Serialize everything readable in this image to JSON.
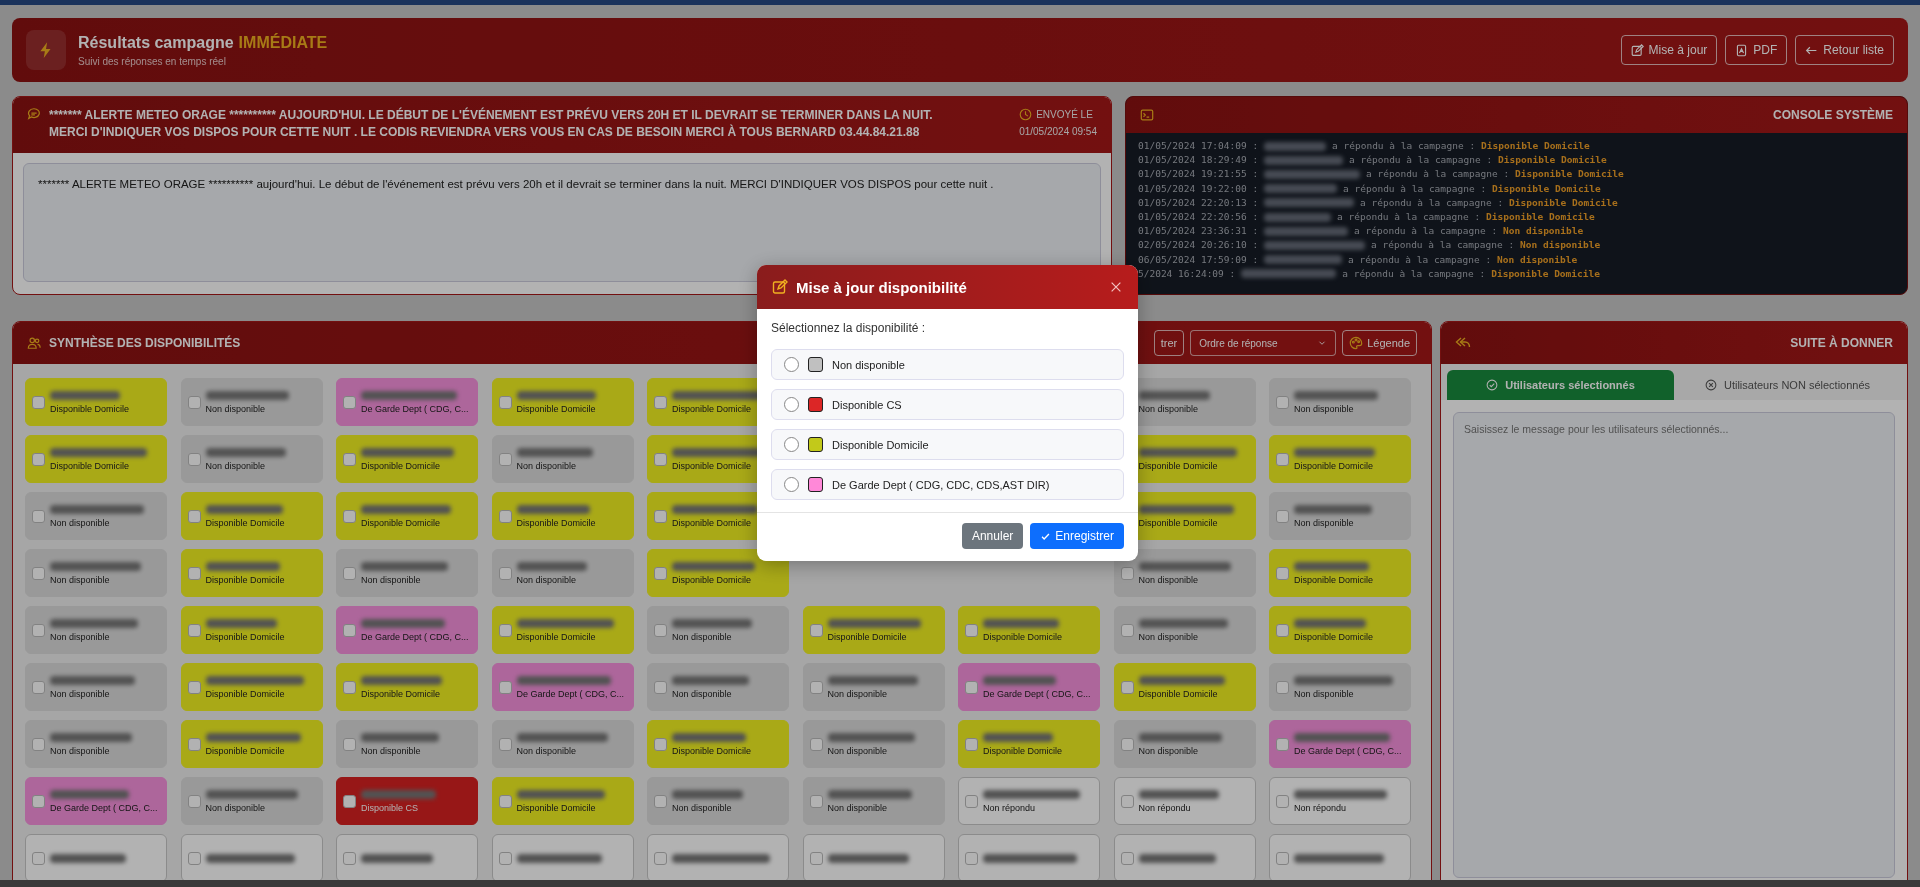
{
  "header": {
    "title": "Résultats campagne",
    "title_highlight": "IMMÉDIATE",
    "subtitle": "Suivi des réponses en temps réel",
    "buttons": [
      {
        "kind": "edit",
        "label": "Mise à jour"
      },
      {
        "kind": "pdf",
        "label": "PDF"
      },
      {
        "kind": "back",
        "label": "Retour liste"
      }
    ]
  },
  "alert": {
    "title": "******* ALERTE METEO ORAGE ********** AUJOURD'HUI. LE DÉBUT DE L'ÉVÉNEMENT EST PRÉVU VERS 20H ET IL DEVRAIT SE TERMINER DANS LA NUIT. MERCI D'INDIQUER VOS DISPOS POUR CETTE NUIT . LE CODIS REVIENDRA VERS VOUS EN CAS DE BESOIN MERCI À TOUS BERNARD 03.44.84.21.88",
    "sent_label": "ENVOYÉ LE",
    "sent_date": "01/05/2024 09:54",
    "message": "******* ALERTE METEO ORAGE ********** aujourd'hui. Le début de l'événement est prévu vers 20h et il devrait se terminer dans la nuit. MERCI D'INDIQUER VOS DISPOS pour cette nuit ."
  },
  "console": {
    "title": "CONSOLE SYSTÈME",
    "lines": [
      {
        "time": "01/05/2024 17:04:09 :",
        "action": "a répondu à la campagne :",
        "status": "Disponible Domicile"
      },
      {
        "time": "01/05/2024 18:29:49 :",
        "action": "a répondu à la campagne :",
        "status": "Disponible Domicile"
      },
      {
        "time": "01/05/2024 19:21:55 :",
        "action": "a répondu à la campagne :",
        "status": "Disponible Domicile"
      },
      {
        "time": "01/05/2024 19:22:00 :",
        "action": "a répondu à la campagne :",
        "status": "Disponible Domicile"
      },
      {
        "time": "01/05/2024 22:20:13 :",
        "action": "a répondu à la campagne :",
        "status": "Disponible Domicile"
      },
      {
        "time": "01/05/2024 22:20:56 :",
        "action": "a répondu à la campagne :",
        "status": "Disponible Domicile"
      },
      {
        "time": "01/05/2024 23:36:31 :",
        "action": "a répondu à la campagne :",
        "status": "Non disponible"
      },
      {
        "time": "02/05/2024 20:26:10 :",
        "action": "a répondu à la campagne :",
        "status": "Non disponible"
      },
      {
        "time": "06/05/2024 17:59:09 :",
        "action": "a répondu à la campagne :",
        "status": "Non disponible"
      },
      {
        "time": "5/2024 16:24:09 :",
        "action": "a répondu à la campagne :",
        "status": "Disponible Domicile"
      }
    ]
  },
  "synthese": {
    "title": "SYNTHÈSE DES DISPONIBILITÉS",
    "filter_button": "trer",
    "sort_select": "Ordre de réponse",
    "legend_button": "Légende",
    "cards": [
      {
        "kind": "home",
        "status": "Disponible Domicile",
        "checked": false
      },
      {
        "kind": "none",
        "status": "Non disponible",
        "checked": false
      },
      {
        "kind": "duty",
        "status": "De Garde Dept ( CDG, C...",
        "checked": false
      },
      {
        "kind": "home",
        "status": "Disponible Domicile",
        "checked": false
      },
      {
        "kind": "home",
        "status": "Disponible Domicile",
        "checked": false
      },
      {
        "kind": "covered"
      },
      {
        "kind": "covered"
      },
      {
        "kind": "none",
        "status": "Non disponible"
      },
      {
        "kind": "none",
        "status": "Non disponible",
        "checked": false
      },
      {
        "kind": "home",
        "status": "Disponible Domicile",
        "checked": false
      },
      {
        "kind": "none",
        "status": "Non disponible",
        "checked": false
      },
      {
        "kind": "home",
        "status": "Disponible Domicile",
        "checked": false
      },
      {
        "kind": "none",
        "status": "Non disponible",
        "checked": false
      },
      {
        "kind": "home",
        "status": "Disponible Domicile",
        "checked": false
      },
      {
        "kind": "covered"
      },
      {
        "kind": "covered"
      },
      {
        "kind": "home",
        "status": "Disponible Domicile"
      },
      {
        "kind": "home",
        "status": "Disponible Domicile",
        "checked": false
      },
      {
        "kind": "none",
        "status": "Non disponible",
        "checked": false
      },
      {
        "kind": "home",
        "status": "Disponible Domicile",
        "checked": false
      },
      {
        "kind": "home",
        "status": "Disponible Domicile",
        "checked": false
      },
      {
        "kind": "home",
        "status": "Disponible Domicile",
        "checked": false
      },
      {
        "kind": "home",
        "status": "Disponible Domicile",
        "checked": false
      },
      {
        "kind": "covered"
      },
      {
        "kind": "covered"
      },
      {
        "kind": "home",
        "status": "Disponible Domicile"
      },
      {
        "kind": "none",
        "status": "Non disponible",
        "checked": false
      },
      {
        "kind": "none",
        "status": "Non disponible",
        "checked": false
      },
      {
        "kind": "home",
        "status": "Disponible Domicile",
        "checked": false
      },
      {
        "kind": "none",
        "status": "Non disponible",
        "checked": false
      },
      {
        "kind": "none",
        "status": "Non disponible",
        "checked": false
      },
      {
        "kind": "home",
        "status": "Disponible Domicile",
        "checked": false
      },
      {
        "kind": "covered"
      },
      {
        "kind": "covered"
      },
      {
        "kind": "none",
        "status": "Non disponible",
        "checked": false
      },
      {
        "kind": "home",
        "status": "Disponible Domicile",
        "checked": false
      },
      {
        "kind": "none",
        "status": "Non disponible",
        "checked": false
      },
      {
        "kind": "home",
        "status": "Disponible Domicile",
        "checked": false
      },
      {
        "kind": "duty",
        "status": "De Garde Dept ( CDG, C...",
        "checked": false
      },
      {
        "kind": "home",
        "status": "Disponible Domicile",
        "checked": false
      },
      {
        "kind": "none",
        "status": "Non disponible",
        "checked": false
      },
      {
        "kind": "home",
        "status": "Disponible Domicile",
        "checked": false
      },
      {
        "kind": "home",
        "status": "Disponible Domicile",
        "checked": false
      },
      {
        "kind": "none",
        "status": "Non disponible",
        "checked": false
      },
      {
        "kind": "home",
        "status": "Disponible Domicile",
        "checked": false
      },
      {
        "kind": "none",
        "status": "Non disponible",
        "checked": false
      },
      {
        "kind": "home",
        "status": "Disponible Domicile",
        "checked": false
      },
      {
        "kind": "home",
        "status": "Disponible Domicile",
        "checked": false
      },
      {
        "kind": "duty",
        "status": "De Garde Dept ( CDG, C...",
        "checked": false
      },
      {
        "kind": "none",
        "status": "Non disponible",
        "checked": false
      },
      {
        "kind": "none",
        "status": "Non disponible",
        "checked": false
      },
      {
        "kind": "duty",
        "status": "De Garde Dept ( CDG, C...",
        "checked": false
      },
      {
        "kind": "home",
        "status": "Disponible Domicile",
        "checked": false
      },
      {
        "kind": "none",
        "status": "Non disponible",
        "checked": false
      },
      {
        "kind": "none",
        "status": "Non disponible",
        "checked": false
      },
      {
        "kind": "home",
        "status": "Disponible Domicile",
        "checked": false
      },
      {
        "kind": "none",
        "status": "Non disponible",
        "checked": false
      },
      {
        "kind": "none",
        "status": "Non disponible",
        "checked": false
      },
      {
        "kind": "home",
        "status": "Disponible Domicile",
        "checked": false
      },
      {
        "kind": "none",
        "status": "Non disponible",
        "checked": false
      },
      {
        "kind": "home",
        "status": "Disponible Domicile",
        "checked": false
      },
      {
        "kind": "none",
        "status": "Non disponible",
        "checked": false
      },
      {
        "kind": "duty",
        "status": "De Garde Dept ( CDG, C...",
        "checked": false
      },
      {
        "kind": "duty",
        "status": "De Garde Dept ( CDG, C...",
        "checked": false
      },
      {
        "kind": "none",
        "status": "Non disponible",
        "checked": false
      },
      {
        "kind": "cs",
        "status": "Disponible CS",
        "checked": false
      },
      {
        "kind": "home",
        "status": "Disponible Domicile",
        "checked": false
      },
      {
        "kind": "none",
        "status": "Non disponible",
        "checked": false
      },
      {
        "kind": "none",
        "status": "Non disponible",
        "checked": false
      },
      {
        "kind": "unanswered",
        "status": "Non répondu",
        "checked": false
      },
      {
        "kind": "unanswered",
        "status": "Non répondu",
        "checked": false
      },
      {
        "kind": "unanswered",
        "status": "Non répondu",
        "checked": false
      },
      {
        "kind": "unanswered",
        "checked": false
      },
      {
        "kind": "unanswered",
        "checked": false
      },
      {
        "kind": "unanswered",
        "checked": false
      },
      {
        "kind": "unanswered",
        "checked": false
      },
      {
        "kind": "unanswered",
        "checked": false
      },
      {
        "kind": "unanswered",
        "checked": false
      },
      {
        "kind": "unanswered",
        "checked": false
      },
      {
        "kind": "unanswered",
        "checked": false
      },
      {
        "kind": "unanswered",
        "checked": false
      }
    ]
  },
  "suite": {
    "title": "SUITE À DONNER",
    "tabs": [
      {
        "label": "Utilisateurs sélectionnés",
        "selected": true
      },
      {
        "label": "Utilisateurs NON sélectionnés",
        "selected": false
      }
    ],
    "message_placeholder": "Saisissez le message pour les utilisateurs sélectionnés..."
  },
  "modal": {
    "title": "Mise à jour disponibilité",
    "prompt": "Sélectionnez la disponibilité :",
    "options": [
      {
        "label": "Non disponible",
        "color": "#c0c0c0",
        "selected": false
      },
      {
        "label": "Disponible CS",
        "color": "#dc2626",
        "selected": false
      },
      {
        "label": "Disponible Domicile",
        "color": "#c2c91a",
        "selected": false
      },
      {
        "label": "De Garde Dept ( CDG, CDC, CDS,AST DIR)",
        "color": "#ff88d8",
        "selected": false
      }
    ],
    "cancel": "Annuler",
    "save": "Enregistrer"
  }
}
